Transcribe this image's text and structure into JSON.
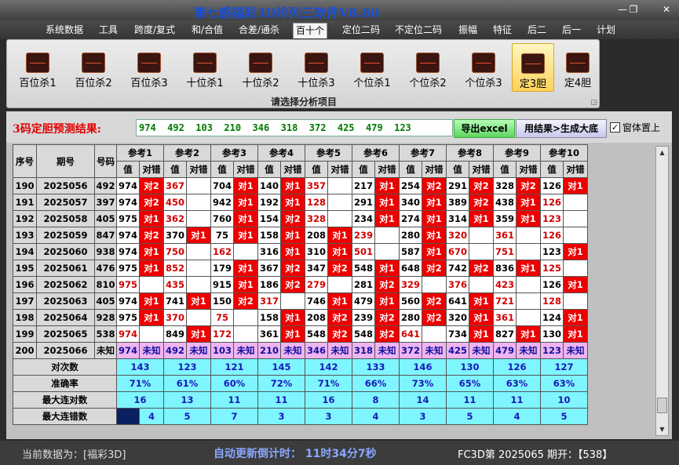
{
  "window": {
    "title": "第七感福彩3D排列三软件V8.80"
  },
  "menu": [
    "系统数据",
    "工具",
    "跨度/复式",
    "和/合值",
    "合差/通杀",
    "百十个",
    "定位二码",
    "不定位二码",
    "振幅",
    "特征",
    "后二",
    "后一",
    "计划"
  ],
  "menu_active": 5,
  "ribbon": {
    "buttons": [
      "百位杀1",
      "百位杀2",
      "百位杀3",
      "十位杀1",
      "十位杀2",
      "十位杀3",
      "个位杀1",
      "个位杀2",
      "个位杀3",
      "定3胆",
      "定4胆"
    ],
    "active": 9,
    "caption": "请选择分析项目"
  },
  "result": {
    "label": "3码定胆预测结果:",
    "value": "974  492  103  210  346  318  372  425  479  123",
    "export_label": "导出excel",
    "generate_label": "用结果>生成大底",
    "ontop_label": "窗体置上",
    "ontop_checked": true
  },
  "grid": {
    "headers": {
      "seq": "序号",
      "period": "期号",
      "number": "号码",
      "val": "值",
      "check": "对错"
    },
    "refs": [
      "参考1",
      "参考2",
      "参考3",
      "参考4",
      "参考5",
      "参考6",
      "参考7",
      "参考8",
      "参考9",
      "参考10"
    ],
    "rows": [
      {
        "seq": "190",
        "period": "2025056",
        "number": "492",
        "cells": [
          [
            "974",
            "",
            "r",
            "对2"
          ],
          [
            "367",
            "r",
            "",
            ""
          ],
          [
            "704",
            "",
            "r",
            "对1"
          ],
          [
            "140",
            "",
            "r",
            "对1"
          ],
          [
            "357",
            "r",
            "",
            ""
          ],
          [
            "217",
            "",
            "r",
            "对1"
          ],
          [
            "254",
            "",
            "r",
            "对2"
          ],
          [
            "291",
            "",
            "r",
            "对2"
          ],
          [
            "328",
            "",
            "r",
            "对2"
          ],
          [
            "126",
            "",
            "r",
            "对1"
          ]
        ]
      },
      {
        "seq": "191",
        "period": "2025057",
        "number": "397",
        "cells": [
          [
            "974",
            "",
            "r",
            "对2"
          ],
          [
            "450",
            "r",
            "",
            ""
          ],
          [
            "942",
            "",
            "r",
            "对1"
          ],
          [
            "192",
            "",
            "r",
            "对1"
          ],
          [
            "128",
            "r",
            "",
            ""
          ],
          [
            "291",
            "",
            "r",
            "对1"
          ],
          [
            "340",
            "",
            "r",
            "对1"
          ],
          [
            "389",
            "",
            "r",
            "对2"
          ],
          [
            "438",
            "",
            "r",
            "对1"
          ],
          [
            "126",
            "r",
            "",
            ""
          ]
        ]
      },
      {
        "seq": "192",
        "period": "2025058",
        "number": "405",
        "cells": [
          [
            "975",
            "",
            "r",
            "对1"
          ],
          [
            "362",
            "r",
            "",
            ""
          ],
          [
            "760",
            "",
            "r",
            "对1"
          ],
          [
            "154",
            "",
            "r",
            "对2"
          ],
          [
            "328",
            "r",
            "",
            ""
          ],
          [
            "234",
            "",
            "r",
            "对1"
          ],
          [
            "274",
            "",
            "r",
            "对1"
          ],
          [
            "314",
            "",
            "r",
            "对1"
          ],
          [
            "359",
            "",
            "r",
            "对1"
          ],
          [
            "123",
            "r",
            "",
            ""
          ]
        ]
      },
      {
        "seq": "193",
        "period": "2025059",
        "number": "847",
        "cells": [
          [
            "974",
            "",
            "r",
            "对2"
          ],
          [
            "370",
            "",
            "r",
            "对1"
          ],
          [
            "75",
            "",
            "r",
            "对1"
          ],
          [
            "158",
            "",
            "r",
            "对1"
          ],
          [
            "208",
            "",
            "r",
            "对1"
          ],
          [
            "239",
            "r",
            "",
            ""
          ],
          [
            "280",
            "",
            "r",
            "对1"
          ],
          [
            "320",
            "r",
            "",
            ""
          ],
          [
            "361",
            "r",
            "",
            ""
          ],
          [
            "126",
            "r",
            "",
            ""
          ]
        ]
      },
      {
        "seq": "194",
        "period": "2025060",
        "number": "938",
        "cells": [
          [
            "974",
            "",
            "r",
            "对1"
          ],
          [
            "750",
            "r",
            "",
            ""
          ],
          [
            "162",
            "r",
            "",
            ""
          ],
          [
            "316",
            "",
            "r",
            "对1"
          ],
          [
            "310",
            "",
            "r",
            "对1"
          ],
          [
            "501",
            "r",
            "",
            ""
          ],
          [
            "587",
            "",
            "r",
            "对1"
          ],
          [
            "670",
            "r",
            "",
            ""
          ],
          [
            "751",
            "r",
            "",
            ""
          ],
          [
            "123",
            "",
            "r",
            "对1"
          ]
        ]
      },
      {
        "seq": "195",
        "period": "2025061",
        "number": "476",
        "cells": [
          [
            "975",
            "",
            "r",
            "对1"
          ],
          [
            "852",
            "r",
            "",
            ""
          ],
          [
            "179",
            "",
            "r",
            "对1"
          ],
          [
            "367",
            "",
            "r",
            "对2"
          ],
          [
            "347",
            "",
            "r",
            "对2"
          ],
          [
            "548",
            "",
            "r",
            "对1"
          ],
          [
            "648",
            "",
            "r",
            "对2"
          ],
          [
            "742",
            "",
            "r",
            "对2"
          ],
          [
            "836",
            "",
            "r",
            "对1"
          ],
          [
            "125",
            "r",
            "",
            ""
          ]
        ]
      },
      {
        "seq": "196",
        "period": "2025062",
        "number": "810",
        "cells": [
          [
            "975",
            "r",
            "",
            ""
          ],
          [
            "435",
            "r",
            "",
            ""
          ],
          [
            "915",
            "",
            "r",
            "对1"
          ],
          [
            "186",
            "",
            "r",
            "对2"
          ],
          [
            "279",
            "r",
            "",
            ""
          ],
          [
            "281",
            "",
            "r",
            "对2"
          ],
          [
            "329",
            "r",
            "",
            ""
          ],
          [
            "376",
            "r",
            "",
            ""
          ],
          [
            "423",
            "r",
            "",
            ""
          ],
          [
            "126",
            "",
            "r",
            "对1"
          ]
        ]
      },
      {
        "seq": "197",
        "period": "2025063",
        "number": "405",
        "cells": [
          [
            "974",
            "",
            "r",
            "对1"
          ],
          [
            "741",
            "",
            "r",
            "对1"
          ],
          [
            "150",
            "",
            "r",
            "对2"
          ],
          [
            "317",
            "r",
            "",
            ""
          ],
          [
            "746",
            "",
            "r",
            "对1"
          ],
          [
            "479",
            "",
            "r",
            "对1"
          ],
          [
            "560",
            "",
            "r",
            "对2"
          ],
          [
            "641",
            "",
            "r",
            "对1"
          ],
          [
            "721",
            "r",
            "",
            ""
          ],
          [
            "128",
            "r",
            "",
            ""
          ]
        ]
      },
      {
        "seq": "198",
        "period": "2025064",
        "number": "928",
        "cells": [
          [
            "975",
            "",
            "r",
            "对1"
          ],
          [
            "370",
            "r",
            "",
            ""
          ],
          [
            "75",
            "r",
            "",
            ""
          ],
          [
            "158",
            "",
            "r",
            "对1"
          ],
          [
            "208",
            "",
            "r",
            "对2"
          ],
          [
            "239",
            "",
            "r",
            "对2"
          ],
          [
            "280",
            "",
            "r",
            "对2"
          ],
          [
            "320",
            "",
            "r",
            "对1"
          ],
          [
            "361",
            "r",
            "",
            ""
          ],
          [
            "124",
            "",
            "r",
            "对1"
          ]
        ]
      },
      {
        "seq": "199",
        "period": "2025065",
        "number": "538",
        "cells": [
          [
            "974",
            "r",
            "",
            ""
          ],
          [
            "849",
            "",
            "r",
            "对1"
          ],
          [
            "172",
            "r",
            "",
            ""
          ],
          [
            "361",
            "",
            "r",
            "对1"
          ],
          [
            "548",
            "",
            "r",
            "对2"
          ],
          [
            "548",
            "",
            "r",
            "对2"
          ],
          [
            "641",
            "r",
            "",
            ""
          ],
          [
            "734",
            "",
            "r",
            "对1"
          ],
          [
            "827",
            "",
            "r",
            "对1"
          ],
          [
            "130",
            "",
            "r",
            "对1"
          ]
        ]
      }
    ],
    "last_row": {
      "seq": "200",
      "period": "2025066",
      "number": "未知",
      "values": [
        "974",
        "492",
        "103",
        "210",
        "346",
        "318",
        "372",
        "425",
        "479",
        "123"
      ],
      "unknown": "未知"
    },
    "stats": [
      {
        "label": "对次数",
        "values": [
          "143",
          "123",
          "121",
          "145",
          "142",
          "133",
          "146",
          "130",
          "126",
          "127"
        ]
      },
      {
        "label": "准确率",
        "values": [
          "71%",
          "61%",
          "60%",
          "72%",
          "71%",
          "66%",
          "73%",
          "65%",
          "63%",
          "63%"
        ]
      },
      {
        "label": "最大连对数",
        "values": [
          "16",
          "13",
          "11",
          "11",
          "16",
          "8",
          "14",
          "11",
          "11",
          "10"
        ]
      },
      {
        "label": "最大连错数",
        "values": [
          "4",
          "5",
          "7",
          "3",
          "3",
          "4",
          "3",
          "5",
          "4",
          "5"
        ]
      }
    ]
  },
  "status": {
    "data_source": "当前数据为：[福彩3D]",
    "countdown": "自动更新倒计时：  11时34分7秒",
    "issue": "FC3D第 2025065 期开：【538】"
  },
  "colors": {
    "hit": "#ee0000",
    "stat": "#7ff5ff",
    "last_row": "#f0b4f0",
    "accent": "#1a4fd6"
  }
}
